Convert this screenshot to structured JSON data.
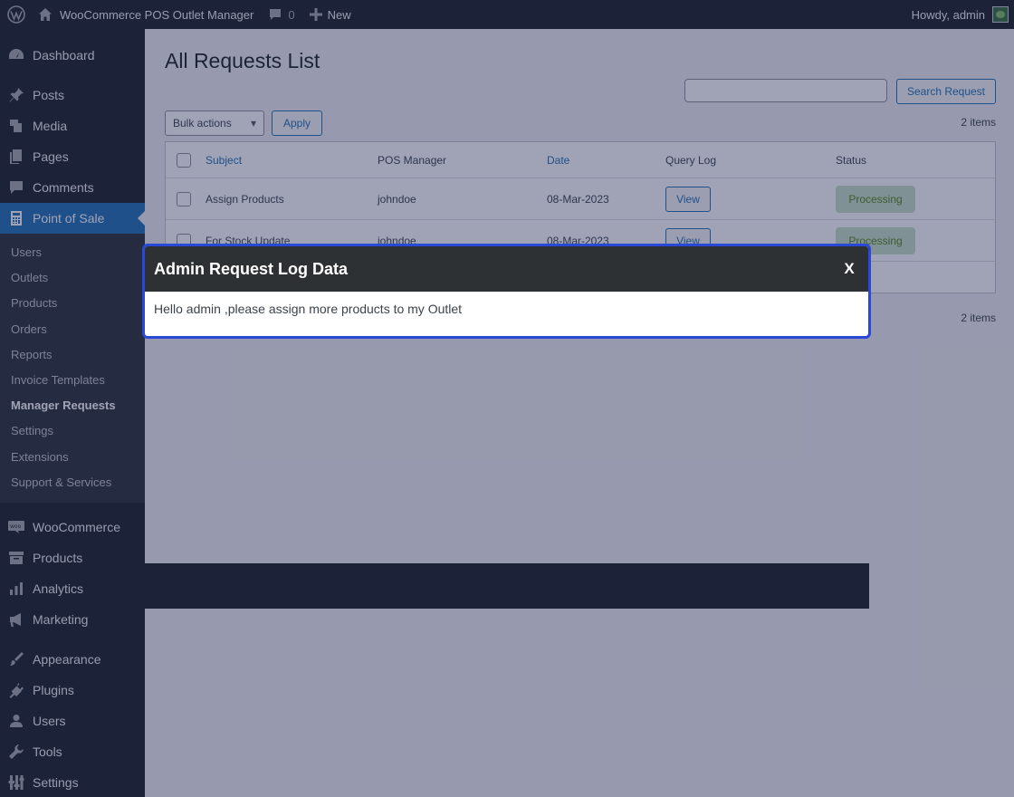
{
  "adminbar": {
    "site_name": "WooCommerce POS Outlet Manager",
    "comments_count": "0",
    "new_label": "New",
    "greeting": "Howdy, admin"
  },
  "sidebar": {
    "items_top": [
      {
        "label": "Dashboard",
        "icon": "dashboard-icon"
      },
      {
        "label": "Posts",
        "icon": "pin-icon"
      },
      {
        "label": "Media",
        "icon": "media-icon"
      },
      {
        "label": "Pages",
        "icon": "pages-icon"
      },
      {
        "label": "Comments",
        "icon": "comment-icon"
      },
      {
        "label": "Point of Sale",
        "icon": "calculator-icon"
      }
    ],
    "pos_submenu": [
      "Users",
      "Outlets",
      "Products",
      "Orders",
      "Reports",
      "Invoice Templates",
      "Manager Requests",
      "Settings",
      "Extensions",
      "Support & Services"
    ],
    "items_bottom": [
      {
        "label": "WooCommerce",
        "icon": "woo-icon"
      },
      {
        "label": "Products",
        "icon": "archive-icon"
      },
      {
        "label": "Analytics",
        "icon": "chart-icon"
      },
      {
        "label": "Marketing",
        "icon": "megaphone-icon"
      },
      {
        "label": "Appearance",
        "icon": "brush-icon"
      },
      {
        "label": "Plugins",
        "icon": "plug-icon"
      },
      {
        "label": "Users",
        "icon": "user-icon"
      },
      {
        "label": "Tools",
        "icon": "wrench-icon"
      },
      {
        "label": "Settings",
        "icon": "settings-icon"
      }
    ]
  },
  "page": {
    "title": "All Requests List",
    "search_button": "Search Request",
    "bulk_actions": "Bulk actions",
    "apply": "Apply",
    "items_count": "2 items",
    "columns": [
      "Subject",
      "POS Manager",
      "Date",
      "Query Log",
      "Status"
    ],
    "rows": [
      {
        "subject": "Assign Products",
        "manager": "johndoe",
        "date": "08-Mar-2023",
        "query": "View",
        "status": "Processing"
      },
      {
        "subject": "For Stock Update",
        "manager": "johndoe",
        "date": "08-Mar-2023",
        "query": "View",
        "status": "Processing"
      }
    ]
  },
  "modal": {
    "title": "Admin Request Log Data",
    "close": "X",
    "message": "Hello admin ,please assign more products to my Outlet"
  },
  "colors": {
    "accent": "#2271b1",
    "modal_border": "#2a48d6",
    "modal_header": "#2d3133",
    "sidebar_bg": "#1d2327"
  }
}
